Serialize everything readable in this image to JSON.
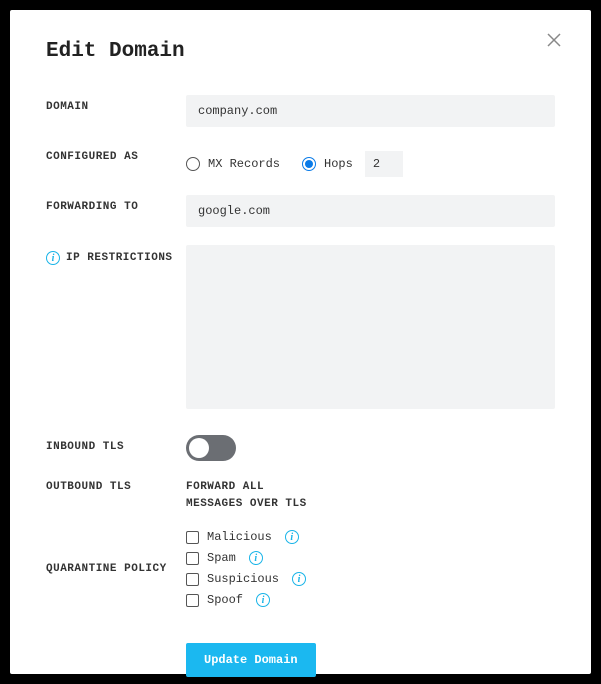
{
  "modal": {
    "title": "Edit Domain",
    "labels": {
      "domain": "DOMAIN",
      "configured_as": "CONFIGURED AS",
      "forwarding_to": "FORWARDING TO",
      "ip_restrictions": "IP RESTRICTIONS",
      "inbound_tls": "INBOUND TLS",
      "outbound_tls": "OUTBOUND TLS",
      "quarantine_policy": "QUARANTINE POLICY"
    },
    "domain_value": "company.com",
    "configured": {
      "mx_label": "MX Records",
      "hops_label": "Hops",
      "hops_value": "2",
      "selected": "hops"
    },
    "forwarding_value": "google.com",
    "ip_restrictions_value": "",
    "inbound_tls_on": false,
    "outbound_tls_text1": "FORWARD ALL",
    "outbound_tls_text2": "MESSAGES OVER TLS",
    "quarantine_options": {
      "malicious": "Malicious",
      "spam": "Spam",
      "suspicious": "Suspicious",
      "spoof": "Spoof"
    },
    "submit_label": "Update Domain"
  }
}
